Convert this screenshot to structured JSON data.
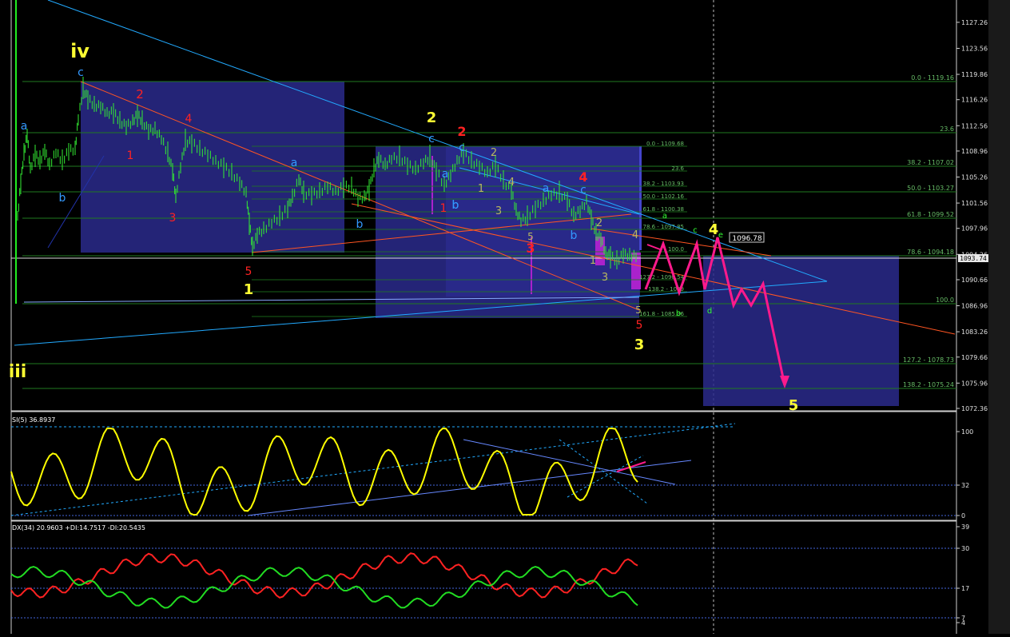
{
  "chart_data": [
    {
      "type": "line",
      "panel": "price",
      "y_axis": {
        "range": [
          1072.36,
          1130.66
        ],
        "ticks": [
          1127.26,
          1123.56,
          1119.86,
          1116.26,
          1112.56,
          1108.96,
          1105.26,
          1101.56,
          1097.96,
          1094.26,
          1090.66,
          1086.96,
          1083.26,
          1079.66,
          1075.96,
          1072.36
        ]
      },
      "current_price_label": "1093.74",
      "target_price_label": "1096.78",
      "fib_levels": [
        {
          "label": "0.0 - 1119.16"
        },
        {
          "label": "23.6"
        },
        {
          "label": "38.2 - 1107.02"
        },
        {
          "label": "50.0 - 1103.27"
        },
        {
          "label": "61.8 - 1099.52"
        },
        {
          "label": "78.6 - 1094.18"
        },
        {
          "label": "100.0"
        },
        {
          "label": "127.2 - 1078.73"
        },
        {
          "label": "138.2 - 1075.24"
        }
      ],
      "fib_levels_small": [
        {
          "label": "0.0 - 1109.68"
        },
        {
          "label": "23.6"
        },
        {
          "label": "38.2 - 1103.93"
        },
        {
          "label": "50.0 - 1102.16"
        },
        {
          "label": "61.8 - 1100.38"
        },
        {
          "label": "78.6 - 1097.85"
        },
        {
          "label": "100.0"
        },
        {
          "label": "127.2 - 1090.54"
        },
        {
          "label": "138.2 - 1089"
        },
        {
          "label": "161.8 - 1085.36"
        }
      ],
      "wave_labels": [
        {
          "text": "iv",
          "color": "#ffff33"
        },
        {
          "text": "iii",
          "color": "#ffff33"
        },
        {
          "text": "a",
          "color": "#3399ff"
        },
        {
          "text": "b",
          "color": "#3399ff"
        },
        {
          "text": "c",
          "color": "#3399ff"
        },
        {
          "text": "2",
          "color": "#ff2222"
        },
        {
          "text": "4",
          "color": "#ff2222"
        },
        {
          "text": "1",
          "color": "#ff2222"
        },
        {
          "text": "3",
          "color": "#ff2222"
        },
        {
          "text": "5",
          "color": "#ff2222"
        },
        {
          "text": "1",
          "color": "#ffff33"
        },
        {
          "text": "a",
          "color": "#3399ff"
        },
        {
          "text": "b",
          "color": "#3399ff"
        },
        {
          "text": "b",
          "color": "#3399ff"
        },
        {
          "text": "2",
          "color": "#ffff33"
        },
        {
          "text": "c",
          "color": "#3399ff"
        },
        {
          "text": "2",
          "color": "#ff2222"
        },
        {
          "text": "c",
          "color": "#3399ff"
        },
        {
          "text": "1",
          "color": "#ff2222"
        },
        {
          "text": "a",
          "color": "#3399ff"
        },
        {
          "text": "b",
          "color": "#3399ff"
        },
        {
          "text": "2",
          "color": "#b8b860"
        },
        {
          "text": "1",
          "color": "#b8b860"
        },
        {
          "text": "4",
          "color": "#b8b860"
        },
        {
          "text": "3",
          "color": "#b8b860"
        },
        {
          "text": "5",
          "color": "#b8b860"
        },
        {
          "text": "3",
          "color": "#ff2222"
        },
        {
          "text": "a",
          "color": "#3399ff"
        },
        {
          "text": "c",
          "color": "#3399ff"
        },
        {
          "text": "4",
          "color": "#ff2222"
        },
        {
          "text": "b",
          "color": "#3399ff"
        },
        {
          "text": "2",
          "color": "#b8b860"
        },
        {
          "text": "1",
          "color": "#b8b860"
        },
        {
          "text": "3",
          "color": "#b8b860"
        },
        {
          "text": "4",
          "color": "#b8b860"
        },
        {
          "text": "5",
          "color": "#b8b860"
        },
        {
          "text": "5",
          "color": "#ff2222"
        },
        {
          "text": "3",
          "color": "#ffff33"
        },
        {
          "text": "a",
          "color": "#33ff33"
        },
        {
          "text": "b",
          "color": "#33ff33"
        },
        {
          "text": "c",
          "color": "#33ff33"
        },
        {
          "text": "d",
          "color": "#33ff33"
        },
        {
          "text": "e",
          "color": "#33ff33"
        },
        {
          "text": "4",
          "color": "#ffff33"
        },
        {
          "text": "5",
          "color": "#ffff33"
        }
      ]
    },
    {
      "type": "line",
      "panel": "indicator",
      "title": "SI(5) 36.8937",
      "y_axis": {
        "ticks": [
          100,
          32,
          0
        ]
      },
      "series": [
        {
          "color": "#ffff00"
        }
      ]
    },
    {
      "type": "line",
      "panel": "indicator",
      "title": "DX(34) 20.9603 +DI:14.7517 -DI:20.5435",
      "y_axis": {
        "ticks": [
          39,
          30,
          17,
          7,
          4
        ]
      },
      "series": [
        {
          "color": "#ff2222"
        },
        {
          "color": "#22dd22"
        }
      ]
    }
  ],
  "colors": {
    "background": "#000000",
    "panel_border": "#d0d0d0",
    "grid_green": "#1f7a1f",
    "box_blue": "#2a2a8c",
    "trend_cyan": "#22aaff",
    "trend_orange": "#ff5522",
    "projection_magenta": "#ff1a8c",
    "candles": "#33ee33"
  }
}
